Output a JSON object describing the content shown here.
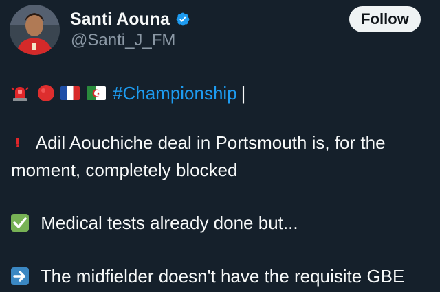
{
  "author": {
    "display_name": "Santi Aouna",
    "handle": "@Santi_J_FM",
    "verified": true
  },
  "follow_button": {
    "label": "Follow"
  },
  "tweet": {
    "header_emojis": [
      "rotating-light-icon",
      "red-circle-icon",
      "france-flag-icon",
      "algeria-flag-icon"
    ],
    "hashtag": "#Championship",
    "separator": "|",
    "paragraph_1": "Adil Aouchiche deal in Portsmouth is, for the moment, completely blocked",
    "paragraph_2": "Medical tests already done but...",
    "paragraph_3": "The midfielder doesn't have the requisite GBE"
  },
  "colors": {
    "background": "#15202b",
    "text_primary": "#f7f9f9",
    "text_secondary": "#8b98a5",
    "link": "#1d9bf0",
    "verified": "#1d9bf0",
    "button_bg": "#eff3f4",
    "button_text": "#0f1419"
  }
}
